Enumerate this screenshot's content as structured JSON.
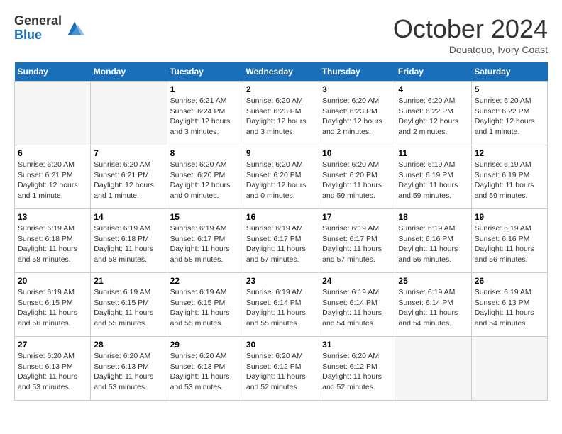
{
  "logo": {
    "general": "General",
    "blue": "Blue"
  },
  "title": "October 2024",
  "subtitle": "Douatouo, Ivory Coast",
  "days_of_week": [
    "Sunday",
    "Monday",
    "Tuesday",
    "Wednesday",
    "Thursday",
    "Friday",
    "Saturday"
  ],
  "weeks": [
    [
      {
        "day": "",
        "info": ""
      },
      {
        "day": "",
        "info": ""
      },
      {
        "day": "1",
        "info": "Sunrise: 6:21 AM\nSunset: 6:24 PM\nDaylight: 12 hours and 3 minutes."
      },
      {
        "day": "2",
        "info": "Sunrise: 6:20 AM\nSunset: 6:23 PM\nDaylight: 12 hours and 3 minutes."
      },
      {
        "day": "3",
        "info": "Sunrise: 6:20 AM\nSunset: 6:23 PM\nDaylight: 12 hours and 2 minutes."
      },
      {
        "day": "4",
        "info": "Sunrise: 6:20 AM\nSunset: 6:22 PM\nDaylight: 12 hours and 2 minutes."
      },
      {
        "day": "5",
        "info": "Sunrise: 6:20 AM\nSunset: 6:22 PM\nDaylight: 12 hours and 1 minute."
      }
    ],
    [
      {
        "day": "6",
        "info": "Sunrise: 6:20 AM\nSunset: 6:21 PM\nDaylight: 12 hours and 1 minute."
      },
      {
        "day": "7",
        "info": "Sunrise: 6:20 AM\nSunset: 6:21 PM\nDaylight: 12 hours and 1 minute."
      },
      {
        "day": "8",
        "info": "Sunrise: 6:20 AM\nSunset: 6:20 PM\nDaylight: 12 hours and 0 minutes."
      },
      {
        "day": "9",
        "info": "Sunrise: 6:20 AM\nSunset: 6:20 PM\nDaylight: 12 hours and 0 minutes."
      },
      {
        "day": "10",
        "info": "Sunrise: 6:20 AM\nSunset: 6:20 PM\nDaylight: 11 hours and 59 minutes."
      },
      {
        "day": "11",
        "info": "Sunrise: 6:19 AM\nSunset: 6:19 PM\nDaylight: 11 hours and 59 minutes."
      },
      {
        "day": "12",
        "info": "Sunrise: 6:19 AM\nSunset: 6:19 PM\nDaylight: 11 hours and 59 minutes."
      }
    ],
    [
      {
        "day": "13",
        "info": "Sunrise: 6:19 AM\nSunset: 6:18 PM\nDaylight: 11 hours and 58 minutes."
      },
      {
        "day": "14",
        "info": "Sunrise: 6:19 AM\nSunset: 6:18 PM\nDaylight: 11 hours and 58 minutes."
      },
      {
        "day": "15",
        "info": "Sunrise: 6:19 AM\nSunset: 6:17 PM\nDaylight: 11 hours and 58 minutes."
      },
      {
        "day": "16",
        "info": "Sunrise: 6:19 AM\nSunset: 6:17 PM\nDaylight: 11 hours and 57 minutes."
      },
      {
        "day": "17",
        "info": "Sunrise: 6:19 AM\nSunset: 6:17 PM\nDaylight: 11 hours and 57 minutes."
      },
      {
        "day": "18",
        "info": "Sunrise: 6:19 AM\nSunset: 6:16 PM\nDaylight: 11 hours and 56 minutes."
      },
      {
        "day": "19",
        "info": "Sunrise: 6:19 AM\nSunset: 6:16 PM\nDaylight: 11 hours and 56 minutes."
      }
    ],
    [
      {
        "day": "20",
        "info": "Sunrise: 6:19 AM\nSunset: 6:15 PM\nDaylight: 11 hours and 56 minutes."
      },
      {
        "day": "21",
        "info": "Sunrise: 6:19 AM\nSunset: 6:15 PM\nDaylight: 11 hours and 55 minutes."
      },
      {
        "day": "22",
        "info": "Sunrise: 6:19 AM\nSunset: 6:15 PM\nDaylight: 11 hours and 55 minutes."
      },
      {
        "day": "23",
        "info": "Sunrise: 6:19 AM\nSunset: 6:14 PM\nDaylight: 11 hours and 55 minutes."
      },
      {
        "day": "24",
        "info": "Sunrise: 6:19 AM\nSunset: 6:14 PM\nDaylight: 11 hours and 54 minutes."
      },
      {
        "day": "25",
        "info": "Sunrise: 6:19 AM\nSunset: 6:14 PM\nDaylight: 11 hours and 54 minutes."
      },
      {
        "day": "26",
        "info": "Sunrise: 6:19 AM\nSunset: 6:13 PM\nDaylight: 11 hours and 54 minutes."
      }
    ],
    [
      {
        "day": "27",
        "info": "Sunrise: 6:20 AM\nSunset: 6:13 PM\nDaylight: 11 hours and 53 minutes."
      },
      {
        "day": "28",
        "info": "Sunrise: 6:20 AM\nSunset: 6:13 PM\nDaylight: 11 hours and 53 minutes."
      },
      {
        "day": "29",
        "info": "Sunrise: 6:20 AM\nSunset: 6:13 PM\nDaylight: 11 hours and 53 minutes."
      },
      {
        "day": "30",
        "info": "Sunrise: 6:20 AM\nSunset: 6:12 PM\nDaylight: 11 hours and 52 minutes."
      },
      {
        "day": "31",
        "info": "Sunrise: 6:20 AM\nSunset: 6:12 PM\nDaylight: 11 hours and 52 minutes."
      },
      {
        "day": "",
        "info": ""
      },
      {
        "day": "",
        "info": ""
      }
    ]
  ]
}
